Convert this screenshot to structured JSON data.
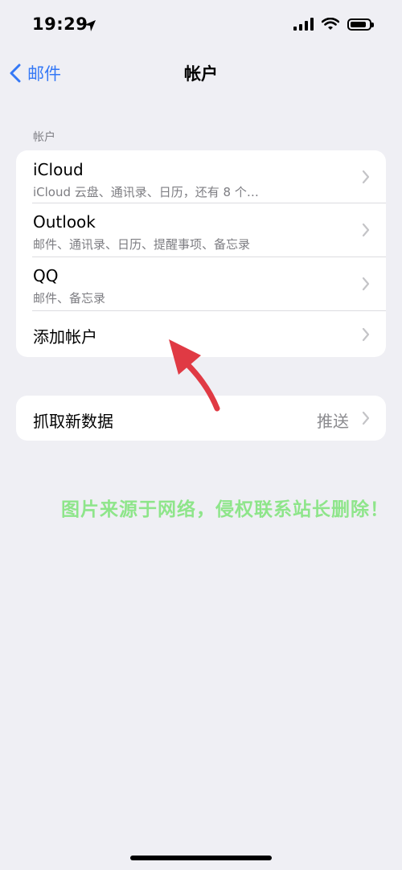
{
  "status_bar": {
    "time": "19:29"
  },
  "nav": {
    "back_label": "邮件",
    "title": "帐户"
  },
  "accounts": {
    "header": "帐户",
    "items": [
      {
        "title": "iCloud",
        "subtitle": "iCloud 云盘、通讯录、日历，还有 8 个…"
      },
      {
        "title": "Outlook",
        "subtitle": "邮件、通讯录、日历、提醒事项、备忘录"
      },
      {
        "title": "QQ",
        "subtitle": "邮件、备忘录"
      },
      {
        "title": "添加帐户"
      }
    ]
  },
  "fetch": {
    "title": "抓取新数据",
    "value": "推送"
  },
  "watermark": "图片来源于网络，侵权联系站长删除！",
  "colors": {
    "accent": "#3478f6",
    "arrow": "#e03a44",
    "watermark": "#8ee58a"
  }
}
